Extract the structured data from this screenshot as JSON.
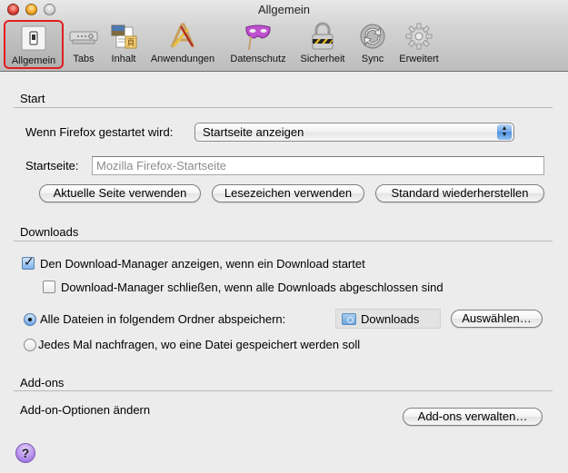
{
  "window": {
    "title": "Allgemein"
  },
  "toolbar": {
    "items": [
      {
        "label": "Allgemein",
        "icon": "switch-icon",
        "selected": true
      },
      {
        "label": "Tabs",
        "icon": "tabs-icon",
        "selected": false
      },
      {
        "label": "Inhalt",
        "icon": "content-icon",
        "selected": false
      },
      {
        "label": "Anwendungen",
        "icon": "applications-icon",
        "selected": false
      },
      {
        "label": "Datenschutz",
        "icon": "privacy-mask-icon",
        "selected": false
      },
      {
        "label": "Sicherheit",
        "icon": "padlock-icon",
        "selected": false
      },
      {
        "label": "Sync",
        "icon": "sync-icon",
        "selected": false
      },
      {
        "label": "Erweitert",
        "icon": "gear-icon",
        "selected": false
      }
    ],
    "selected_border_color": "#e21d1d"
  },
  "start": {
    "heading": "Start",
    "when_starts_label": "Wenn Firefox gestartet wird:",
    "when_starts_value": "Startseite anzeigen",
    "homepage_label": "Startseite:",
    "homepage_placeholder": "Mozilla Firefox-Startseite",
    "homepage_value": "",
    "buttons": {
      "use_current": "Aktuelle Seite verwenden",
      "use_bookmark": "Lesezeichen verwenden",
      "restore_default": "Standard wiederherstellen"
    }
  },
  "downloads": {
    "heading": "Downloads",
    "show_manager": {
      "label": "Den Download-Manager anzeigen, wenn ein Download startet",
      "checked": true
    },
    "close_manager": {
      "label": "Download-Manager schließen, wenn alle Downloads abgeschlossen sind",
      "checked": false
    },
    "save_to": {
      "label": "Alle Dateien in folgendem Ordner abspeichern:",
      "selected": true
    },
    "folder_name": "Downloads",
    "choose_button": "Auswählen…",
    "always_ask": {
      "label": "Jedes Mal nachfragen, wo eine Datei gespeichert werden soll",
      "selected": false
    }
  },
  "addons": {
    "heading": "Add-ons",
    "change_options_label": "Add-on-Optionen ändern",
    "manage_button": "Add-ons verwalten…"
  },
  "help": {
    "glyph": "?"
  }
}
